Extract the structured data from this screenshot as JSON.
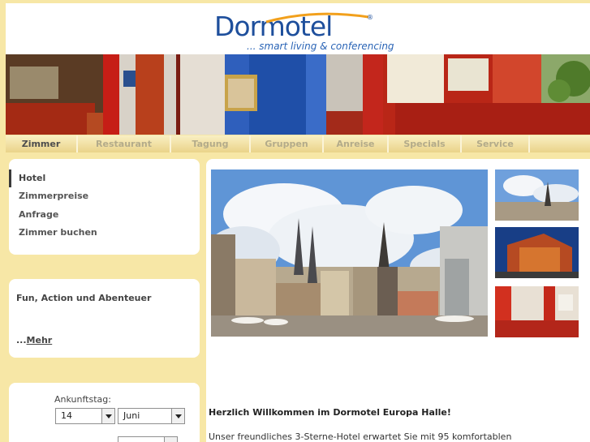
{
  "brand": {
    "logo_text": "Dormotel",
    "tagline": "... smart living & conferencing"
  },
  "nav": {
    "items": [
      {
        "label": "Zimmer",
        "active": true
      },
      {
        "label": "Restaurant",
        "active": false
      },
      {
        "label": "Tagung",
        "active": false
      },
      {
        "label": "Gruppen",
        "active": false
      },
      {
        "label": "Anreise",
        "active": false
      },
      {
        "label": "Specials",
        "active": false
      },
      {
        "label": "Service",
        "active": false
      }
    ]
  },
  "sidebar": {
    "menu": [
      {
        "label": "Hotel",
        "active": true
      },
      {
        "label": "Zimmerpreise",
        "active": false
      },
      {
        "label": "Anfrage",
        "active": false
      },
      {
        "label": "Zimmer buchen",
        "active": false
      }
    ],
    "promo": {
      "title": "Fun, Action und Abenteuer",
      "more_prefix": "...",
      "more_link": "Mehr"
    },
    "booking": {
      "arrival_label": "Ankunftstag:",
      "day_value": "14",
      "month_value": "Juni"
    }
  },
  "main": {
    "welcome_title": "Herzlich Willkommen im Dormotel Europa Halle!",
    "welcome_text": "Unser freundliches 3-Sterne-Hotel erwartet Sie mit 95 komfortablen"
  },
  "colors": {
    "background": "#f7e7a6",
    "brand_blue": "#1e4f9c",
    "logo_orange": "#f2a01c",
    "panel": "#ffffff"
  }
}
